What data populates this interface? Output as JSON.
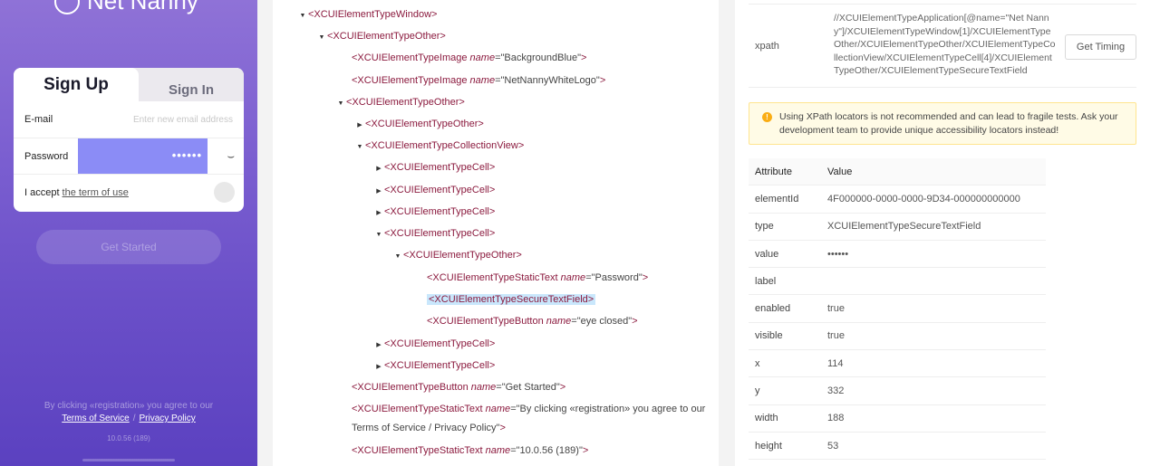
{
  "phone": {
    "logo_text": "Net Nanny",
    "tabs": {
      "sign_up": "Sign Up",
      "sign_in": "Sign In"
    },
    "email": {
      "label": "E-mail",
      "placeholder": "Enter new email address"
    },
    "password": {
      "label": "Password",
      "value": "••••••"
    },
    "accept": {
      "prefix": "I accept",
      "link": "the term of use"
    },
    "get_started": "Get Started",
    "legal_line": "By clicking «registration» you agree to our",
    "terms_link": "Terms of Service",
    "separator": "/",
    "privacy_link": "Privacy Policy",
    "version": "10.0.56 (189)",
    "colors": {
      "gradient_top": "#8f72d7",
      "gradient_bottom": "#5b41c0",
      "password_highlight": "#8b8cf6"
    }
  },
  "tree": {
    "nodes": [
      {
        "caret": "▼",
        "tag": "<XCUIElementTypeWindow>",
        "attr": "",
        "val": "",
        "close": ""
      },
      {
        "caret": "▼",
        "tag": "<XCUIElementTypeOther>",
        "attr": "",
        "val": "",
        "close": ""
      },
      {
        "caret": "",
        "tag": "<XCUIElementTypeImage ",
        "attr": "name",
        "val": "=\"BackgroundBlue\"",
        "close": ">"
      },
      {
        "caret": "",
        "tag": "<XCUIElementTypeImage ",
        "attr": "name",
        "val": "=\"NetNannyWhiteLogo\"",
        "close": ">"
      },
      {
        "caret": "▼",
        "tag": "<XCUIElementTypeOther>",
        "attr": "",
        "val": "",
        "close": ""
      },
      {
        "caret": "▶",
        "tag": "<XCUIElementTypeOther>",
        "attr": "",
        "val": "",
        "close": ""
      },
      {
        "caret": "▼",
        "tag": "<XCUIElementTypeCollectionView>",
        "attr": "",
        "val": "",
        "close": ""
      },
      {
        "caret": "▶",
        "tag": "<XCUIElementTypeCell>",
        "attr": "",
        "val": "",
        "close": ""
      },
      {
        "caret": "▶",
        "tag": "<XCUIElementTypeCell>",
        "attr": "",
        "val": "",
        "close": ""
      },
      {
        "caret": "▶",
        "tag": "<XCUIElementTypeCell>",
        "attr": "",
        "val": "",
        "close": ""
      },
      {
        "caret": "▼",
        "tag": "<XCUIElementTypeCell>",
        "attr": "",
        "val": "",
        "close": ""
      },
      {
        "caret": "▼",
        "tag": "<XCUIElementTypeOther>",
        "attr": "",
        "val": "",
        "close": ""
      },
      {
        "caret": "",
        "tag": "<XCUIElementTypeStaticText ",
        "attr": "name",
        "val": "=\"Password\"",
        "close": ">"
      },
      {
        "caret": "",
        "tag": "<XCUIElementTypeSecureTextField>",
        "attr": "",
        "val": "",
        "close": ""
      },
      {
        "caret": "",
        "tag": "<XCUIElementTypeButton ",
        "attr": "name",
        "val": "=\"eye closed\"",
        "close": ">"
      },
      {
        "caret": "▶",
        "tag": "<XCUIElementTypeCell>",
        "attr": "",
        "val": "",
        "close": ""
      },
      {
        "caret": "▶",
        "tag": "<XCUIElementTypeCell>",
        "attr": "",
        "val": "",
        "close": ""
      },
      {
        "caret": "",
        "tag": "<XCUIElementTypeButton ",
        "attr": "name",
        "val": "=\"Get Started\"",
        "close": ">"
      },
      {
        "caret": "",
        "tag": "<XCUIElementTypeStaticText ",
        "attr": "name",
        "val": "=\"By clicking «registration» you agree to our",
        "close": ""
      },
      {
        "caret": "",
        "tag": "",
        "attr": "",
        "val": "Terms of Service / Privacy Policy\"",
        "close": ">"
      },
      {
        "caret": "",
        "tag": "<XCUIElementTypeStaticText ",
        "attr": "name",
        "val": "=\"10.0.56 (189)\"",
        "close": ">"
      }
    ]
  },
  "inspector": {
    "xpath_label": "xpath",
    "xpath_value": "//XCUIElementTypeApplication[@name=\"Net Nanny\"]/XCUIElementTypeWindow[1]/XCUIElementTypeOther/XCUIElementTypeOther/XCUIElementTypeCollectionView/XCUIElementTypeCell[4]/XCUIElementTypeOther/XCUIElementTypeSecureTextField",
    "timing_button": "Get Timing",
    "warning_icon": "exclamation-circle-icon",
    "warning_text": "Using XPath locators is not recommended and can lead to fragile tests. Ask your development team to provide unique accessibility locators instead!",
    "table": {
      "headers": [
        "Attribute",
        "Value"
      ],
      "rows": [
        [
          "elementId",
          "4F000000-0000-0000-9D34-000000000000"
        ],
        [
          "type",
          "XCUIElementTypeSecureTextField"
        ],
        [
          "value",
          "••••••"
        ],
        [
          "label",
          ""
        ],
        [
          "enabled",
          "true"
        ],
        [
          "visible",
          "true"
        ],
        [
          "x",
          "114"
        ],
        [
          "y",
          "332"
        ],
        [
          "width",
          "188"
        ],
        [
          "height",
          "53"
        ]
      ]
    }
  }
}
